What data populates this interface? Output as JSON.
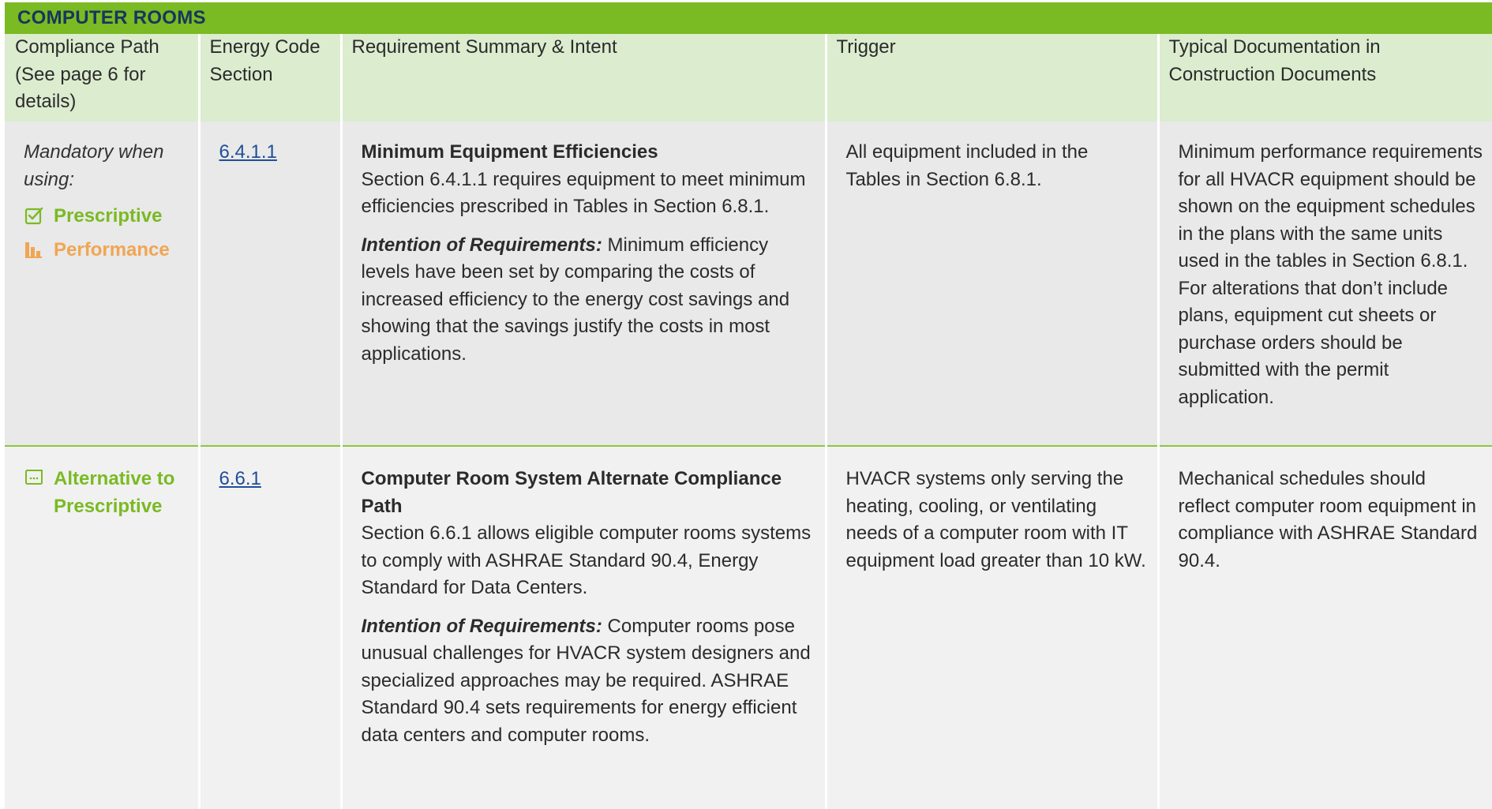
{
  "section": {
    "title": "COMPUTER ROOMS"
  },
  "headers": {
    "compliance_path": "Compliance Path (See page 6 for details)",
    "energy_code_section": "Energy Code Section",
    "requirement": "Requirement Summary & Intent",
    "trigger": "Trigger",
    "documentation": "Typical Documentation in Construction Documents"
  },
  "rows": [
    {
      "path_intro": "Mandatory when using:",
      "paths": [
        "Prescriptive",
        "Performance"
      ],
      "section": "6.4.1.1",
      "title": "Minimum Equipment Efficiencies",
      "summary": "Section 6.4.1.1 requires equipment to meet minimum efficiencies prescribed in Tables in Section 6.8.1.",
      "intent_label": "Intention of Requirements:",
      "intent_text": " Minimum efficiency levels have been set by comparing the costs of increased efficiency to the energy cost savings and showing that the savings justify the costs in most applications.",
      "trigger": "All equipment included in the Tables in Section 6.8.1.",
      "documentation": "Minimum performance requirements for all HVACR equipment should be shown on the equipment schedules in the plans with the same units used in the tables in Section 6.8.1. For alterations that don’t include plans, equipment cut sheets or purchase orders should be submitted with the permit application."
    },
    {
      "paths": [
        "Alternative to Prescriptive"
      ],
      "section": "6.6.1",
      "title": "Computer Room System Alternate Compliance Path",
      "summary": "Section 6.6.1 allows eligible computer rooms systems to comply with ASHRAE Standard 90.4, Energy Standard for Data Centers.",
      "intent_label": "Intention of Requirements:",
      "intent_text": " Computer rooms pose unusual challenges for HVACR system designers and specialized approaches may be required. ASHRAE Standard 90.4 sets requirements for energy efficient data centers and computer rooms.",
      "trigger": "HVACR systems only serving the heating, cooling, or ventilating needs of a computer room with IT equipment load greater than 10 kW.",
      "documentation": "Mechanical schedules should reflect computer room equipment in compliance with ASHRAE Standard 90.4."
    }
  ],
  "colors": {
    "accent_green": "#7aba23",
    "performance_orange": "#f1a553",
    "header_bg": "#dceccf",
    "title_text": "#17365d"
  },
  "icons": {
    "prescriptive": "checkbox-icon",
    "performance": "bar-chart-icon",
    "alternative": "document-icon"
  }
}
